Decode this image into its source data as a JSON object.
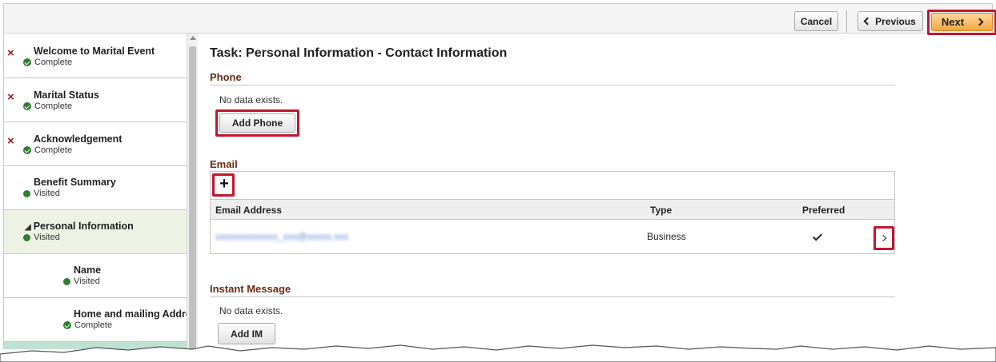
{
  "toolbar": {
    "cancel_label": "Cancel",
    "previous_label": "Previous",
    "next_label": "Next"
  },
  "sidebar": {
    "items": [
      {
        "title": "Welcome to Marital Event",
        "status": "Complete",
        "required": true,
        "status_icon": "check-circle-icon"
      },
      {
        "title": "Marital Status",
        "status": "Complete",
        "required": true,
        "status_icon": "check-circle-icon"
      },
      {
        "title": "Acknowledgement",
        "status": "Complete",
        "required": true,
        "status_icon": "check-circle-icon"
      },
      {
        "title": "Benefit Summary",
        "status": "Visited",
        "required": false,
        "status_icon": "dot-icon"
      },
      {
        "title": "Personal Information",
        "status": "Visited",
        "required": false,
        "status_icon": "dot-icon",
        "expanded": true
      },
      {
        "title": "Name",
        "status": "Visited",
        "required": false,
        "status_icon": "dot-icon"
      },
      {
        "title": "Home and mailing Address",
        "status": "Complete",
        "required": false,
        "status_icon": "check-circle-icon"
      }
    ],
    "required_marker": "×"
  },
  "main": {
    "task_title": "Task: Personal Information - Contact Information",
    "phone": {
      "heading": "Phone",
      "no_data": "No data exists.",
      "add_label": "Add Phone"
    },
    "email": {
      "heading": "Email",
      "add_icon": "plus-icon",
      "columns": [
        "Email Address",
        "Type",
        "Preferred"
      ],
      "rows": [
        {
          "address": "xxxxxxxxxxxxx_xxx@xxxxx.xxx",
          "type": "Business",
          "preferred": true
        }
      ]
    },
    "instant_message": {
      "heading": "Instant Message",
      "no_data": "No data exists.",
      "add_label": "Add IM"
    }
  },
  "colors": {
    "highlight": "#c0172e",
    "section_heading": "#6b2a12",
    "next_button": "#f3a742",
    "status_green": "#2e7d32",
    "active_step_bg": "#eef2e4"
  }
}
